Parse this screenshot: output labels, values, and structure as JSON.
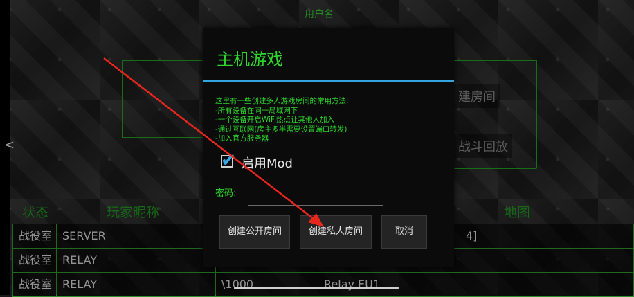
{
  "lobby": {
    "username_label": "用户名",
    "back_chevron": "<",
    "create_room": "建房间",
    "battle_replay": "战斗回放",
    "columns": {
      "status": "状态",
      "nickname": "玩家昵称",
      "map": "地图"
    },
    "rows": [
      {
        "status": "战役室",
        "name": "SERVER",
        "version": "",
        "map": "",
        "extra": "4]"
      },
      {
        "status": "战役室",
        "name": "RELAY",
        "version": "",
        "map": "",
        "extra": ""
      },
      {
        "status": "战役室",
        "name": "RELAY",
        "version": "\\1000",
        "map": "Relay EU1",
        "extra": ""
      }
    ]
  },
  "dialog": {
    "title": "主机游戏",
    "description": "这里有一些创建多人游戏房间的常用方法:\n-所有设备在同一局域网下\n-一个设备开启WiFi热点让其他人加入\n-通过互联网(房主多半需要设置端口转发)\n-加入官方服务器",
    "enable_mod_label": "启用Mod",
    "enable_mod_checked": true,
    "password_label": "密码:",
    "password_value": "",
    "password_placeholder": "",
    "btn_public": "创建公开房间",
    "btn_private": "创建私人房间",
    "btn_cancel": "取消"
  },
  "colors": {
    "accent_green": "#2ed62e",
    "separator_blue": "#33a6e0",
    "annotation_arrow": "#e8261c"
  }
}
